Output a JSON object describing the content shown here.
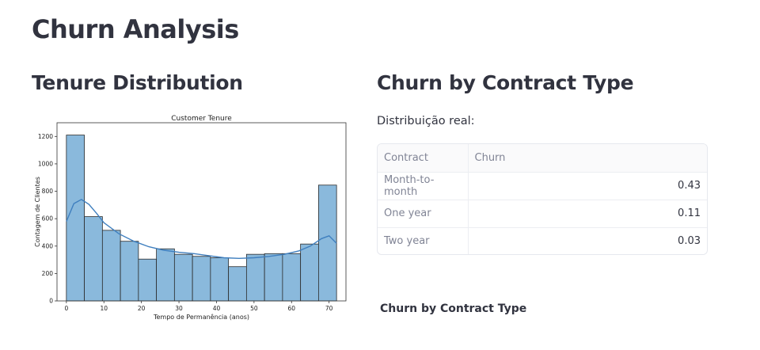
{
  "page": {
    "title": "Churn Analysis"
  },
  "left": {
    "section_title": "Tenure Distribution"
  },
  "right": {
    "section_title": "Churn by Contract Type",
    "caption": "Distribuição real:",
    "table": {
      "columns": [
        "Contract",
        "Churn"
      ],
      "rows": [
        {
          "contract": "Month-to-month",
          "churn": "0.43"
        },
        {
          "contract": "One year",
          "churn": "0.11"
        },
        {
          "contract": "Two year",
          "churn": "0.03"
        }
      ]
    },
    "bottom_label": "Churn by Contract Type"
  },
  "chart_data": {
    "type": "bar",
    "title": "Customer Tenure",
    "xlabel": "Tempo de Permanência (anos)",
    "ylabel": "Contagem de Clientes",
    "xlim": [
      -2.5,
      74.5
    ],
    "ylim": [
      0,
      1300
    ],
    "xticks": [
      0,
      10,
      20,
      30,
      40,
      50,
      60,
      70
    ],
    "yticks": [
      0,
      200,
      400,
      600,
      800,
      1000,
      1200
    ],
    "bin_edges": [
      0,
      4.8,
      9.6,
      14.4,
      19.2,
      24,
      28.8,
      33.6,
      38.4,
      43.2,
      48,
      52.8,
      57.6,
      62.4,
      67.2,
      72
    ],
    "counts": [
      1210,
      615,
      515,
      435,
      305,
      380,
      340,
      325,
      315,
      250,
      340,
      345,
      345,
      415,
      845
    ],
    "kde": {
      "x": [
        0,
        2,
        4,
        6,
        8,
        10,
        14,
        18,
        22,
        26,
        30,
        34,
        38,
        42,
        46,
        50,
        54,
        58,
        62,
        65,
        68,
        70,
        72
      ],
      "y": [
        580,
        710,
        740,
        705,
        640,
        570,
        490,
        435,
        395,
        370,
        355,
        345,
        330,
        315,
        310,
        315,
        325,
        340,
        365,
        400,
        455,
        475,
        420
      ]
    },
    "colors": {
      "bar_fill": "#8ab9dc",
      "bar_edge": "#2b2b2b",
      "kde_line": "#3f7fbf"
    },
    "grid": false,
    "legend": "none"
  }
}
